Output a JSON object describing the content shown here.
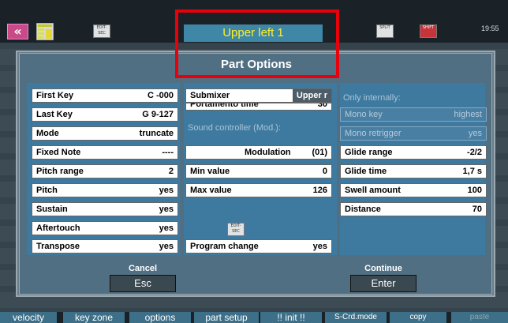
{
  "header": {
    "close_glyph": "«",
    "menu_icon": "menu-icon",
    "edit_icon_label": "EDIT-SEC",
    "title": "Upper left 1",
    "split_icon_label": "SPLIT",
    "shift_icon_label": "SHIFT",
    "time": "19:55"
  },
  "modal": {
    "title": "Part Options",
    "left_rows": [
      {
        "label": "First Key",
        "value": "C  -000"
      },
      {
        "label": "Last Key",
        "value": "G 9-127"
      },
      {
        "label": "Mode",
        "value": "truncate"
      },
      {
        "label": "Fixed Note",
        "value": "----"
      },
      {
        "label": "Pitch range",
        "value": "2"
      },
      {
        "label": "Pitch",
        "value": "yes"
      },
      {
        "label": "Sustain",
        "value": "yes"
      },
      {
        "label": "Aftertouch",
        "value": "yes"
      },
      {
        "label": "Transpose",
        "value": "yes"
      }
    ],
    "middle": {
      "submixer_label": "Submixer",
      "submixer_value": "Upper r",
      "portamento_label": "Portamento time",
      "portamento_value": "30",
      "sound_controller_label": "Sound controller (Mod.):",
      "controller_value": "Modulation",
      "controller_number": "(01)",
      "min_label": "Min value",
      "min_value": "0",
      "max_label": "Max value",
      "max_value": "126",
      "program_change_label": "Program change",
      "program_change_value": "yes"
    },
    "right": {
      "section_label": "Only internally:",
      "rows": [
        {
          "label": "Mono key",
          "value": "highest",
          "enabled": false
        },
        {
          "label": "Mono retrigger",
          "value": "yes",
          "enabled": false
        },
        {
          "label": "Glide range",
          "value": "-2/2",
          "enabled": true
        },
        {
          "label": "Glide time",
          "value": "1,7 s",
          "enabled": true
        },
        {
          "label": "Swell amount",
          "value": "100",
          "enabled": true
        },
        {
          "label": "Distance",
          "value": "70",
          "enabled": true
        }
      ]
    },
    "cancel_label": "Cancel",
    "cancel_button": "Esc",
    "continue_label": "Continue",
    "continue_button": "Enter",
    "center_icon_label": "EDIT-SEC"
  },
  "bottom_bar": [
    "velocity",
    "key zone",
    "options",
    "part setup",
    "!! init !!",
    "S-Crd.mode",
    "copy",
    "paste"
  ],
  "colors": {
    "accent_title": "#ffef2a",
    "highlight_box": "#e8000b",
    "panel_blue": "#3e7aa0"
  }
}
